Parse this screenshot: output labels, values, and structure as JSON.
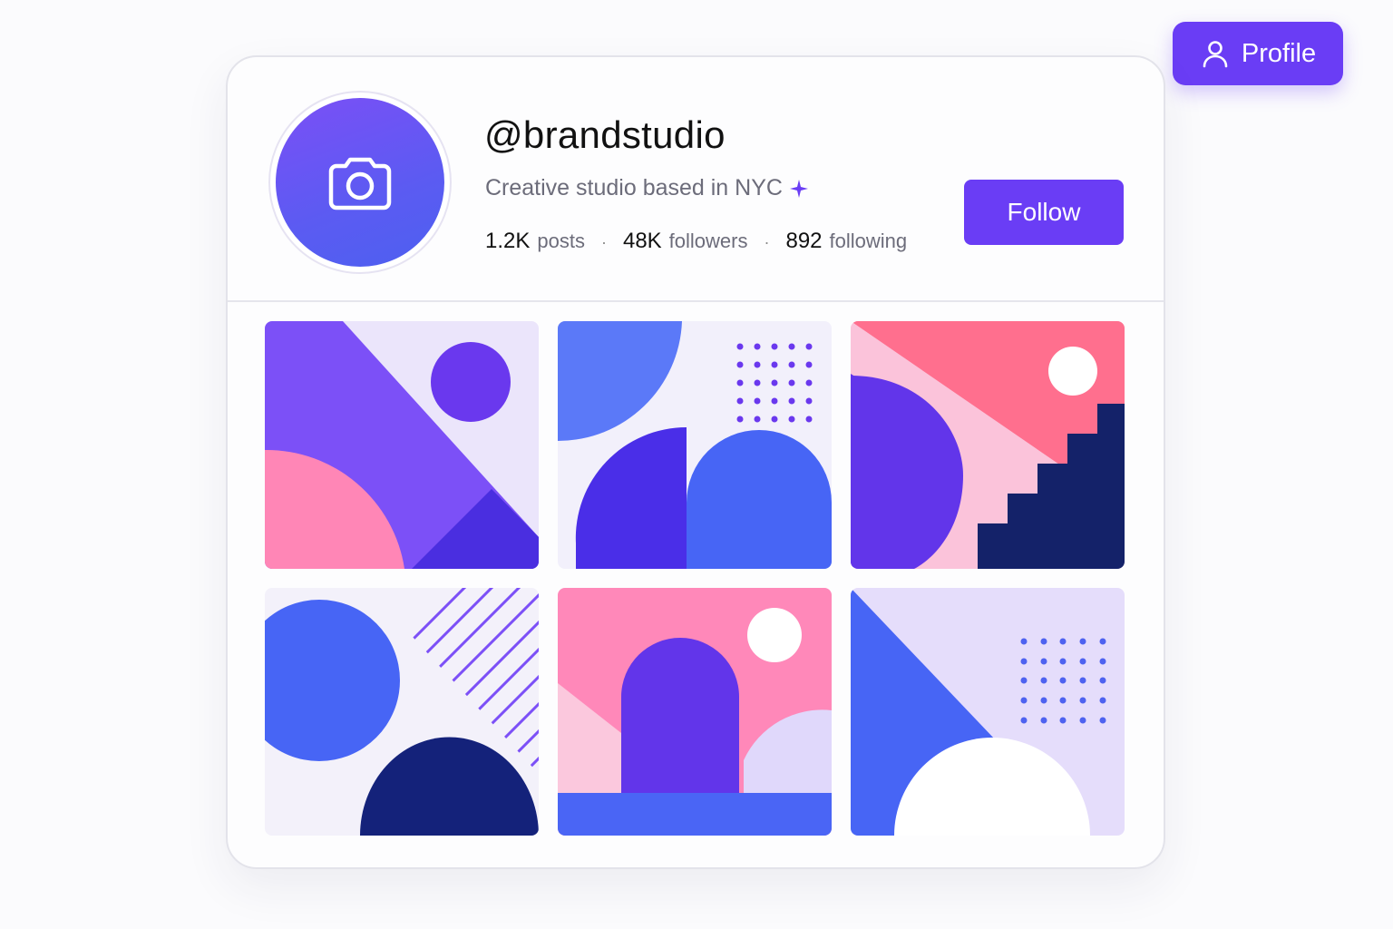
{
  "header": {
    "profile_button_label": "Profile",
    "profile_icon": "user-icon"
  },
  "profile": {
    "avatar_icon": "camera-icon",
    "handle": "@brandstudio",
    "bio": "Creative studio based in NYC",
    "bio_icon": "sparkle-icon",
    "stats": {
      "posts_count": "1.2K",
      "posts_label": "posts",
      "followers_count": "48K",
      "followers_label": "followers",
      "following_count": "892",
      "following_label": "following",
      "separator": "·"
    },
    "follow_button_label": "Follow"
  },
  "grid": {
    "posts": [
      {
        "name": "post-1"
      },
      {
        "name": "post-2"
      },
      {
        "name": "post-3"
      },
      {
        "name": "post-4"
      },
      {
        "name": "post-5"
      },
      {
        "name": "post-6"
      }
    ]
  },
  "colors": {
    "accent": "#6a3df5",
    "violet": "#7b4ff6",
    "blue": "#4765f5",
    "pink": "#ff86b6",
    "navy": "#14227a",
    "lavender": "#ebe6fb"
  }
}
